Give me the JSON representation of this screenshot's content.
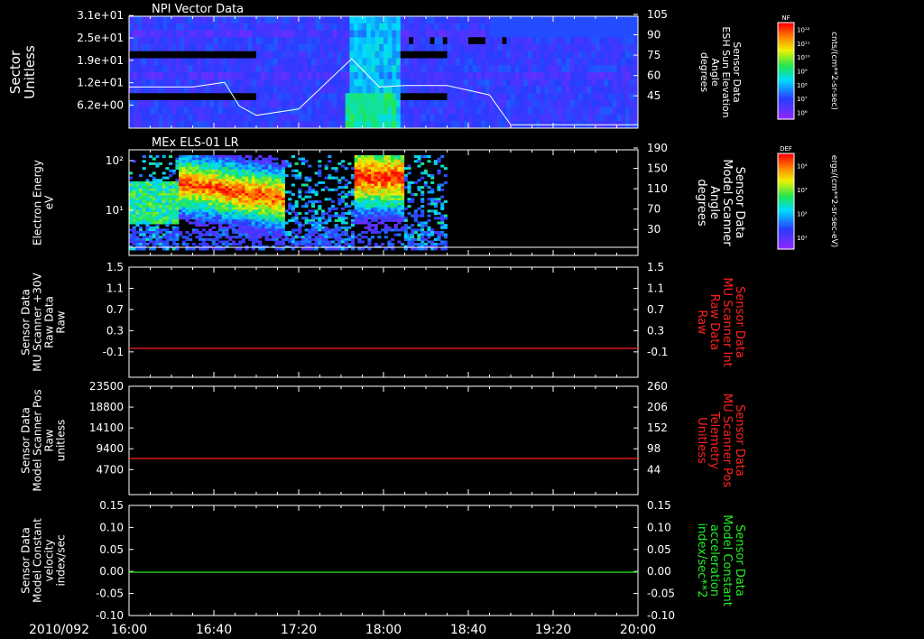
{
  "date_label": "2010/092",
  "time_ticks": [
    "16:00",
    "16:40",
    "17:20",
    "18:00",
    "18:40",
    "19:20",
    "20:00"
  ],
  "colorbars": [
    {
      "title": "NF",
      "unit": "cnts/(cm**2-sr-sec)",
      "ticks": [
        "10¹²",
        "10¹¹",
        "10¹⁰",
        "10⁹",
        "10⁸",
        "10⁷",
        "10⁶"
      ]
    },
    {
      "title": "DEF",
      "unit": "ergs/(cm**2-sr-sec-eV)",
      "ticks": [
        "10⁴",
        "10³",
        "10²",
        "10¹"
      ]
    }
  ],
  "panels": [
    {
      "title": "NPI Vector Data",
      "left_label": [
        "Sector",
        "Unitless"
      ],
      "left_ticks": [
        "3.1e+01",
        "2.5e+01",
        "1.9e+01",
        "1.2e+01",
        "6.2e+00"
      ],
      "right_label": [
        "Sensor Data",
        "ESH Sun Elevation",
        "Angle",
        "degrees"
      ],
      "right_ticks": [
        "105",
        "90",
        "75",
        "60",
        "45"
      ],
      "right_color": "#ffffff"
    },
    {
      "title": "MEx ELS-01 LR",
      "left_label": [
        "Electron Energy",
        "eV"
      ],
      "left_ticks": [
        "10²",
        "10¹"
      ],
      "right_label": [
        "Sensor Data",
        "Model Scanner",
        "Angle",
        "degrees"
      ],
      "right_ticks": [
        "190",
        "150",
        "110",
        "70",
        "30"
      ],
      "right_color": "#ffffff"
    },
    {
      "title": "",
      "left_label": [
        "Sensor Data",
        "MU Scanner +30V",
        "Raw Data",
        "Raw"
      ],
      "left_ticks": [
        "1.5",
        "1.1",
        "0.7",
        "0.3",
        "-0.1"
      ],
      "right_label": [
        "Sensor Data",
        "MU Scanner Int",
        "Raw Data",
        "Raw"
      ],
      "right_ticks": [
        "1.5",
        "1.1",
        "0.7",
        "0.3",
        "-0.1"
      ],
      "right_color": "#ff2020"
    },
    {
      "title": "",
      "left_label": [
        "Sensor Data",
        "Model Scanner Pos",
        "Raw",
        "unitless"
      ],
      "left_ticks": [
        "23500",
        "18800",
        "14100",
        "9400",
        "4700"
      ],
      "right_label": [
        "Sensor Data",
        "MU Scanner Pos",
        "Telemetry",
        "Unitless"
      ],
      "right_ticks": [
        "260",
        "206",
        "152",
        "98",
        "44"
      ],
      "right_color": "#ff2020"
    },
    {
      "title": "",
      "left_label": [
        "Sensor Data",
        "Model Constant",
        "velocity",
        "index/sec"
      ],
      "left_ticks": [
        "0.15",
        "0.10",
        "0.05",
        "0.00",
        "-0.05",
        "-0.10"
      ],
      "right_label": [
        "Sensor Data",
        "Model Constant",
        "acceleration",
        "index/sec**2"
      ],
      "right_ticks": [
        "0.15",
        "0.10",
        "0.05",
        "0.00",
        "-0.05",
        "-0.10"
      ],
      "right_color": "#22ee22"
    }
  ],
  "chart_data": [
    {
      "type": "heatmap",
      "title": "NPI Vector Data",
      "x": "time 16:00–20:00",
      "overlay_line": {
        "name": "ESH Sun Elevation Angle",
        "time": [
          "16:00",
          "16:30",
          "16:45",
          "16:52",
          "17:00",
          "17:20",
          "17:45",
          "17:58",
          "18:10",
          "18:30",
          "18:50",
          "19:00",
          "20:00"
        ],
        "values": [
          60,
          60,
          63,
          48,
          42,
          46,
          78,
          60,
          61,
          61,
          55,
          36,
          36
        ]
      }
    },
    {
      "type": "heatmap",
      "title": "MEx ELS-01 LR",
      "data_extent": [
        "16:00",
        "18:30"
      ],
      "overlay_line": {
        "name": "Model Scanner Angle",
        "values": [
          10,
          10
        ]
      }
    },
    {
      "type": "line",
      "series": [
        {
          "name": "MU Scanner +30V Raw Data",
          "time": [
            "16:00",
            "20:00"
          ],
          "values": [
            0.03,
            0.03
          ]
        }
      ]
    },
    {
      "type": "line",
      "series": [
        {
          "name": "Model Scanner Pos",
          "time": [
            "16:00",
            "20:00"
          ],
          "values": [
            8850,
            8850
          ]
        }
      ]
    },
    {
      "type": "line",
      "series": [
        {
          "name": "Model Constant velocity",
          "time": [
            "16:00",
            "20:00"
          ],
          "values": [
            0.0,
            0.0
          ]
        }
      ]
    }
  ]
}
